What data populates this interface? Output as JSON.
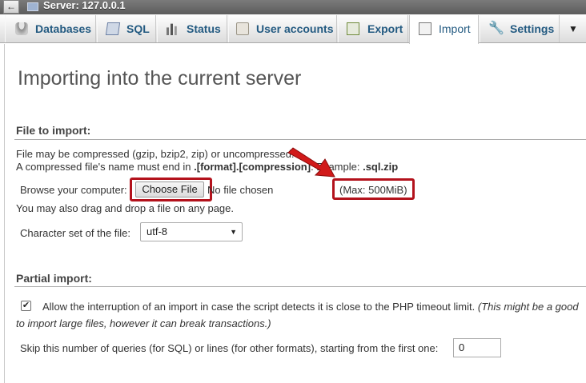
{
  "server_bar": {
    "label": "Server: 127.0.0.1"
  },
  "tabs": [
    {
      "label": "Databases",
      "icon": "database-icon"
    },
    {
      "label": "SQL",
      "icon": "sql-icon"
    },
    {
      "label": "Status",
      "icon": "status-icon"
    },
    {
      "label": "User accounts",
      "icon": "user-accounts-icon"
    },
    {
      "label": "Export",
      "icon": "export-icon"
    },
    {
      "label": "Import",
      "icon": "import-icon",
      "active": true
    },
    {
      "label": "Settings",
      "icon": "wrench-icon"
    }
  ],
  "more_menu_glyph": "▼",
  "page": {
    "title": "Importing into the current server"
  },
  "file_section": {
    "title": "File to import:",
    "compress_line": "File may be compressed (gzip, bzip2, zip) or uncompressed.",
    "name_line_prefix": "A compressed file's name must end in ",
    "name_line_format": ".[format].[compression]",
    "name_line_middle": ". Example: ",
    "name_line_example": ".sql.zip",
    "browse_label": "Browse your computer:",
    "choose_file_button": "Choose File",
    "no_file_text": "No file chosen",
    "max_size": "(Max: 500MiB)",
    "drag_drop_text": "You may also drag and drop a file on any page.",
    "charset_label": "Character set of the file:",
    "charset_value": "utf-8"
  },
  "partial_section": {
    "title": "Partial import:",
    "allow_interrupt_label": "Allow the interruption of an import in case the script detects it is close to the PHP timeout limit.",
    "allow_interrupt_note_1": "(This might be a good",
    "allow_interrupt_note_2": "to import large files, however it can break transactions.)",
    "allow_interrupt_checked": true,
    "skip_label": "Skip this number of queries (for SQL) or lines (for other formats), starting from the first one:",
    "skip_value": "0"
  },
  "colors": {
    "highlight": "#b3121c",
    "link": "#235a81"
  }
}
